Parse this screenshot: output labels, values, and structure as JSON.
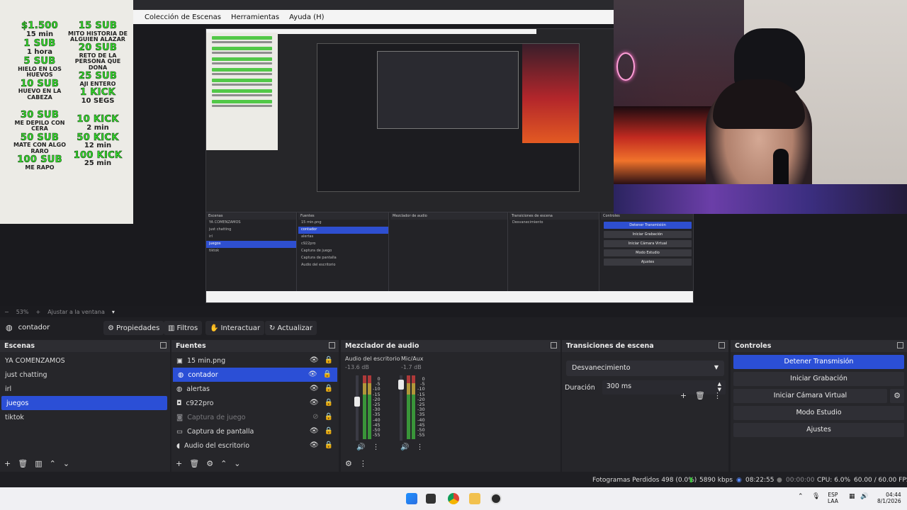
{
  "donations": {
    "left": [
      {
        "head": "$1.500",
        "sub": "15 min"
      },
      {
        "head": "1 SUB",
        "sub": "1 hora"
      },
      {
        "head": "5 SUB",
        "sub": "HIELO EN LOS HUEVOS"
      },
      {
        "head": "10 SUB",
        "sub": "HUEVO EN LA CABEZA"
      },
      {
        "head": "30 SUB",
        "sub": "ME DEPILO CON CERA"
      },
      {
        "head": "50 SUB",
        "sub": "MATE CON ALGO RARO"
      },
      {
        "head": "100 SUB",
        "sub": "ME RAPO"
      }
    ],
    "right": [
      {
        "head": "15 SUB",
        "sub": "MITO HISTORIA DE ALGUIEN ALAZAR"
      },
      {
        "head": "20 SUB",
        "sub": "RETO DE LA PERSONA QUE DONA"
      },
      {
        "head": "25 SUB",
        "sub": "AJI ENTERO"
      },
      {
        "head": "1 KICK",
        "sub": "10 SEGS"
      },
      {
        "head": "10 KICK",
        "sub": "2 min"
      },
      {
        "head": "50 KICK",
        "sub": "12 min"
      },
      {
        "head": "100 KICK",
        "sub": "25 min"
      }
    ]
  },
  "obs_menu": [
    "Colección de Escenas",
    "Herramientas",
    "Ayuda (H)"
  ],
  "zoom": {
    "minus": "−",
    "level": "53%",
    "plus": "+",
    "mode": "Ajustar a la ventana",
    "arrow": "▾"
  },
  "source_bar": {
    "current_source": "contador",
    "properties": "Propiedades",
    "filters": "Filtros",
    "interact": "Interactuar",
    "refresh": "Actualizar"
  },
  "scenes": {
    "title": "Escenas",
    "items": [
      "YA COMENZAMOS",
      "just chatting",
      "irl",
      "juegos",
      "tiktok"
    ],
    "selected_index": 3
  },
  "sources": {
    "title": "Fuentes",
    "items": [
      {
        "label": "15 min.png",
        "icon": "image-icon",
        "glyph": "▣",
        "visible": true,
        "locked": true,
        "dim": false
      },
      {
        "label": "contador",
        "icon": "browser-icon",
        "glyph": "◍",
        "visible": true,
        "locked": true,
        "dim": false
      },
      {
        "label": "alertas",
        "icon": "browser-icon",
        "glyph": "◍",
        "visible": true,
        "locked": true,
        "dim": false
      },
      {
        "label": "c922pro",
        "icon": "camera-icon",
        "glyph": "◘",
        "visible": true,
        "locked": true,
        "dim": false
      },
      {
        "label": "Captura de juego",
        "icon": "gamepad-icon",
        "glyph": "◙",
        "visible": false,
        "locked": true,
        "dim": true
      },
      {
        "label": "Captura de pantalla",
        "icon": "monitor-icon",
        "glyph": "▭",
        "visible": true,
        "locked": true,
        "dim": false
      },
      {
        "label": "Audio del escritorio",
        "icon": "speaker-icon",
        "glyph": "◖",
        "visible": true,
        "locked": true,
        "dim": false
      }
    ],
    "selected_index": 1
  },
  "mixer": {
    "title": "Mezclador de audio",
    "channels": [
      {
        "name": "Audio del escritorio",
        "db": "-13.6 dB"
      },
      {
        "name": "Mic/Aux",
        "db": "-1.7 dB"
      }
    ],
    "scale": [
      "0",
      "-5",
      "-10",
      "-15",
      "-20",
      "-25",
      "-30",
      "-35",
      "-40",
      "-45",
      "-50",
      "-55",
      "-60"
    ]
  },
  "transitions": {
    "title": "Transiciones de escena",
    "selected": "Desvanecimiento",
    "duration_label": "Duración",
    "duration_value": "300 ms"
  },
  "controls": {
    "title": "Controles",
    "stop_stream": "Detener Transmisión",
    "start_recording": "Iniciar Grabación",
    "start_virtual_cam": "Iniciar Cámara Virtual",
    "studio_mode": "Modo Estudio",
    "settings": "Ajustes"
  },
  "status": {
    "dropped_frames": "Fotogramas Perdidos 498 (0.0%)",
    "bitrate": "5890 kbps",
    "stream_time": "08:22:55",
    "record_time": "00:00:00",
    "cpu": "CPU: 6.0%",
    "fps": "60.00 / 60.00 FPS"
  },
  "tray": {
    "lang_1": "ESP",
    "lang_2": "LAA",
    "time": "04:44",
    "date": "8/1/2026"
  },
  "colors": {
    "accent": "#2b4fd6",
    "panel": "#26262a",
    "background": "#1f1f23",
    "donation_green": "#37e12f"
  }
}
